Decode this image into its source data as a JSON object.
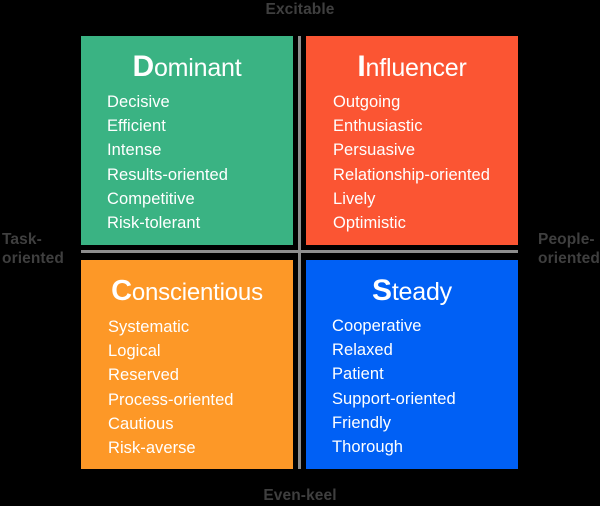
{
  "chart_data": {
    "type": "table",
    "title": "DISC personality quadrant model",
    "xlabel": "Task-oriented ↔ People-oriented",
    "ylabel": "Excitable ↔ Even-keel",
    "grid": false,
    "legend": "none",
    "axes": {
      "top": "Excitable",
      "bottom": "Even-keel",
      "left": "Task-\noriented",
      "right": "People-\noriented"
    },
    "quadrants": [
      {
        "position": "top-left",
        "initial": "D",
        "rest": "ominant",
        "title": "Dominant",
        "color": "#3ab383",
        "traits": [
          "Decisive",
          "Efficient",
          "Intense",
          "Results-oriented",
          "Competitive",
          "Risk-tolerant"
        ]
      },
      {
        "position": "top-right",
        "initial": "I",
        "rest": "nfluencer",
        "title": "Influencer",
        "color": "#fb5533",
        "traits": [
          "Outgoing",
          "Enthusiastic",
          "Persuasive",
          "Relationship-oriented",
          "Lively",
          "Optimistic"
        ]
      },
      {
        "position": "bottom-left",
        "initial": "C",
        "rest": "onscientious",
        "title": "Conscientious",
        "color": "#fd9827",
        "traits": [
          "Systematic",
          "Logical",
          "Reserved",
          "Process-oriented",
          "Cautious",
          "Risk-averse"
        ]
      },
      {
        "position": "bottom-right",
        "initial": "S",
        "rest": "teady",
        "title": "Steady",
        "color": "#0060f5",
        "traits": [
          "Cooperative",
          "Relaxed",
          "Patient",
          "Support-oriented",
          "Friendly",
          "Thorough"
        ]
      }
    ],
    "colors": {
      "background": "#000000",
      "axis_line": "#8e8e8e",
      "axis_label_text": "#3f3f3f",
      "quadrant_text": "#ffffff"
    }
  }
}
